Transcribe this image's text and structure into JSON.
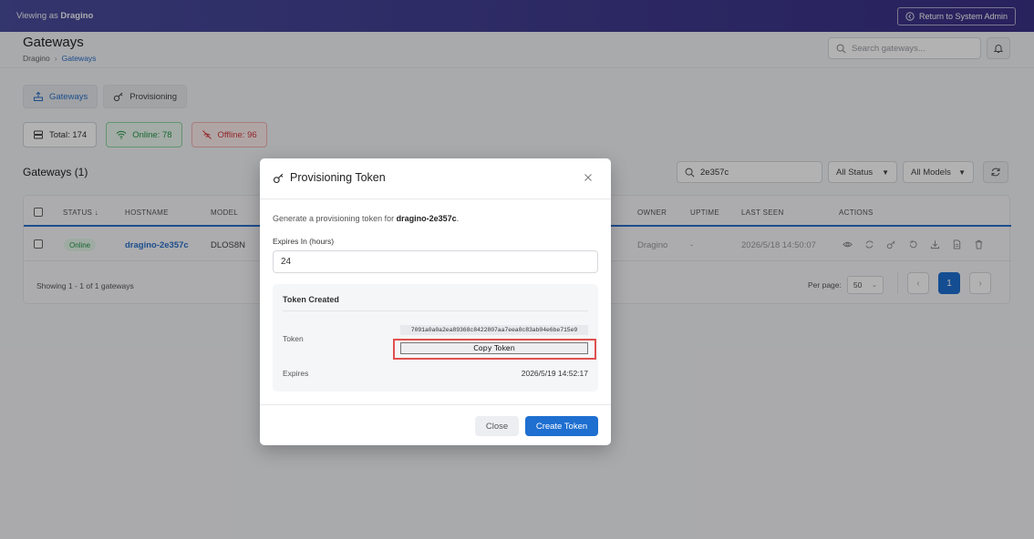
{
  "topbar": {
    "viewing_prefix": "Viewing as",
    "viewing_org": "Dragino",
    "return_label": "Return to System Admin"
  },
  "header": {
    "title": "Gateways",
    "breadcrumb": [
      "Dragino",
      "Gateways"
    ],
    "search_placeholder": "Search gateways..."
  },
  "tabs": [
    {
      "label": "Gateways",
      "icon": "gateway-icon",
      "active": true
    },
    {
      "label": "Provisioning",
      "icon": "key-icon",
      "active": false
    }
  ],
  "stats": {
    "total": "Total: 174",
    "online": "Online: 78",
    "offline": "Offline: 96"
  },
  "list": {
    "title": "Gateways (1)",
    "filter_search_value": "2e357c",
    "status_filter": "All Status",
    "model_filter": "All Models"
  },
  "table": {
    "columns": [
      "STATUS",
      "HOSTNAME",
      "MODEL",
      "OWNER",
      "UPTIME",
      "LAST SEEN",
      "ACTIONS"
    ],
    "sort_indicator": "↓",
    "rows": [
      {
        "status": "Online",
        "hostname": "dragino-2e357c",
        "model": "DLOS8N",
        "owner": "Dragino",
        "uptime": "-",
        "last_seen": "2026/5/18 14:50:07"
      }
    ],
    "footer": "Showing 1 - 1 of 1 gateways",
    "per_page_label": "Per page:",
    "per_page_value": "50",
    "current_page": "1"
  },
  "modal": {
    "title": "Provisioning Token",
    "description_prefix": "Generate a provisioning token for",
    "description_host": "dragino-2e357c",
    "description_suffix": ".",
    "expires_label": "Expires In (hours)",
    "expires_value": "24",
    "token_created_title": "Token Created",
    "token_label": "Token",
    "token_value": "7091a0a0a2ea89368c8422807aa7eea0c83ab04e6be715e9",
    "copy_button": "Copy Token",
    "expires_row_label": "Expires",
    "expires_row_value": "2026/5/19 14:52:17",
    "close_button": "Close",
    "create_button": "Create Token"
  },
  "colors": {
    "topbar": "#3f3a8e",
    "primary": "#1e6fd0",
    "online": "#239447",
    "offline": "#d2393e",
    "highlight": "#e0504f"
  }
}
